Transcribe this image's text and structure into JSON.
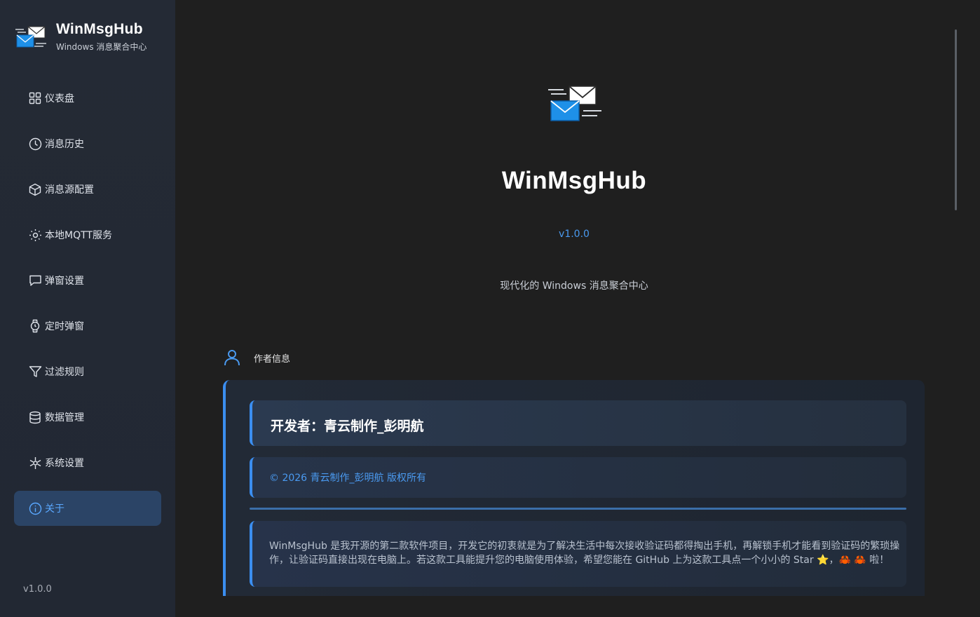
{
  "app": {
    "name": "WinMsgHub",
    "subtitle": "Windows 消息聚合中心",
    "version": "v1.0.0"
  },
  "sidebar": {
    "items": [
      {
        "label": "仪表盘",
        "icon": "dashboard-icon"
      },
      {
        "label": "消息历史",
        "icon": "clock-icon"
      },
      {
        "label": "消息源配置",
        "icon": "cube-icon"
      },
      {
        "label": "本地MQTT服务",
        "icon": "sun-icon"
      },
      {
        "label": "弹窗设置",
        "icon": "chat-bubble-icon"
      },
      {
        "label": "定时弹窗",
        "icon": "watch-icon"
      },
      {
        "label": "过滤规则",
        "icon": "filter-icon"
      },
      {
        "label": "数据管理",
        "icon": "database-icon"
      },
      {
        "label": "系统设置",
        "icon": "gear-icon"
      },
      {
        "label": "关于",
        "icon": "info-icon",
        "active": true
      }
    ],
    "version": "v1.0.0"
  },
  "about": {
    "title": "WinMsgHub",
    "version": "v1.0.0",
    "description": "现代化的 Windows 消息聚合中心",
    "author_section_label": "作者信息",
    "developer": "开发者：青云制作_彭明航",
    "copyright": "© 2026 青云制作_彭明航 版权所有",
    "intro": "WinMsgHub 是我开源的第二款软件项目，开发它的初衷就是为了解决生活中每次接收验证码都得掏出手机，再解锁手机才能看到验证码的繁琐操作，让验证码直接出现在电脑上。若这款工具能提升您的电脑使用体验，希望您能在 GitHub 上为这款工具点一个小小的 Star ⭐，🦀 🦀 啦！"
  },
  "colors": {
    "accent": "#3b8ef0",
    "link": "#4a9af0",
    "sidebar_bg": "#242a35",
    "main_bg": "#1f1f1f",
    "active_bg": "#2b4466"
  }
}
